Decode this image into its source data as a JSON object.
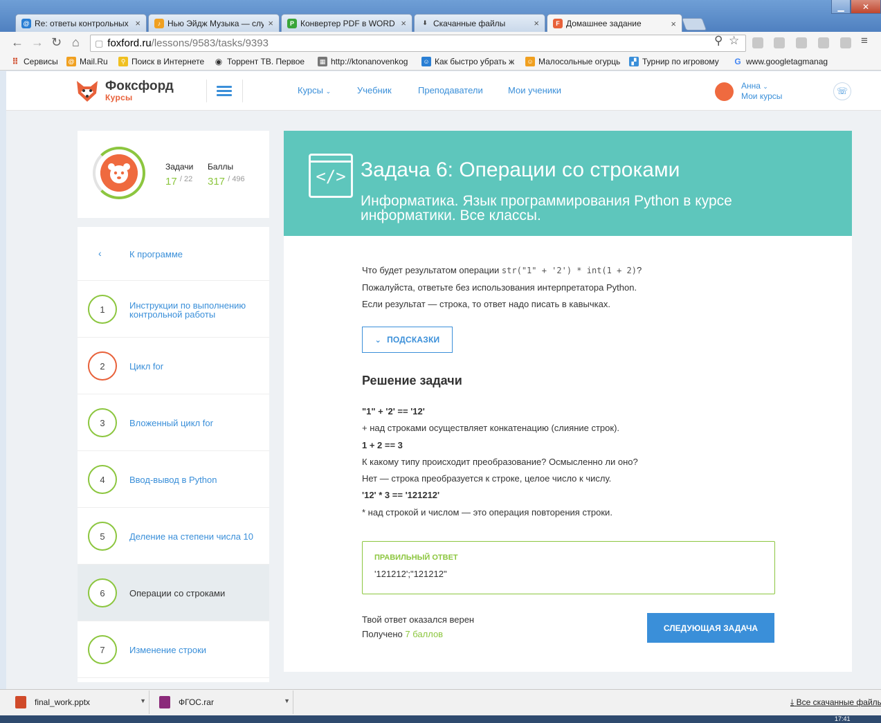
{
  "browser": {
    "tabs": [
      {
        "title": "Re: ответы контрольных",
        "active": false
      },
      {
        "title": "Нью Эйдж Музыка — слу",
        "active": false
      },
      {
        "title": "Конвертер PDF в WORD",
        "active": false
      },
      {
        "title": "Скачанные файлы",
        "active": false
      },
      {
        "title": "Домашнее задание",
        "active": true
      }
    ],
    "url_host": "foxford.ru",
    "url_path": "/lessons/9583/tasks/9393",
    "bookmarks": [
      "Сервисы",
      "Mail.Ru",
      "Поиск в Интернете",
      "Торрент ТВ. Первое",
      "http://ktonanovenkog",
      "Как быстро убрать ж",
      "Малосольные огурцы",
      "Турнир по игровому",
      "www.googletagmanag"
    ]
  },
  "header": {
    "logo_name": "Фоксфорд",
    "logo_sub": "Курсы",
    "nav": [
      "Курсы",
      "Учебник",
      "Преподаватели",
      "Мои ученики"
    ],
    "user_name": "Анна",
    "user_sub": "Мои курсы"
  },
  "profile": {
    "tasks_label": "Задачи",
    "tasks_done": "17",
    "tasks_total": "/ 22",
    "points_label": "Баллы",
    "points_done": "317",
    "points_total": "/ 496"
  },
  "sidebar": {
    "back_label": "К программе",
    "lessons": [
      {
        "num": "1",
        "title": "Инструкции по выполнению контрольной работы"
      },
      {
        "num": "2",
        "title": "Цикл for"
      },
      {
        "num": "3",
        "title": "Вложенный цикл for"
      },
      {
        "num": "4",
        "title": "Ввод-вывод в Python"
      },
      {
        "num": "5",
        "title": "Деление на степени числа 10"
      },
      {
        "num": "6",
        "title": "Операции со строками"
      },
      {
        "num": "7",
        "title": "Изменение строки"
      }
    ]
  },
  "task": {
    "title": "Задача 6: Операции со строками",
    "subtitle": "Информатика. Язык программирования Python в курсе информатики. Все классы.",
    "question_prefix": "Что будет результатом операции ",
    "question_code": "str(\"1\" + '2') * int(1 + 2)",
    "question_suffix": "?",
    "line2": "Пожалуйста, ответьте без использования интерпретатора Python.",
    "line3": "Если результат — строка, то ответ надо писать в кавычках.",
    "hints_label": "ПОДСКАЗКИ",
    "solution_heading": "Решение задачи",
    "solution_lines": [
      "\"1\" + '2' == '12'",
      "+ над строками осуществляет конкатенацию (слияние строк).",
      "1 + 2 == 3",
      "К какому типу происходит преобразование? Осмысленно ли оно?",
      "Нет — строка преобразуется к строке, целое число к числу.",
      "'12' * 3 == '121212'",
      "* над строкой и числом — это операция повторения строки."
    ],
    "answer_caption": "ПРАВИЛЬНЫЙ ОТВЕТ",
    "answer_value": "'121212';\"121212\"",
    "result_text": "Твой ответ оказался верен",
    "points_prefix": "Получено ",
    "points_value": "7 баллов",
    "next_label": "СЛЕДУЮЩАЯ ЗАДАЧА"
  },
  "downloads": {
    "items": [
      "final_work.pptx",
      "ФГОС.rar"
    ],
    "all_label": "Все скачанные файлы"
  },
  "taskbar": {
    "clock": "17:41"
  },
  "colors": {
    "accent_blue": "#3a8fd9",
    "teal_banner": "#5ec6bc",
    "green": "#8cc63f",
    "orange": "#e8613a"
  }
}
